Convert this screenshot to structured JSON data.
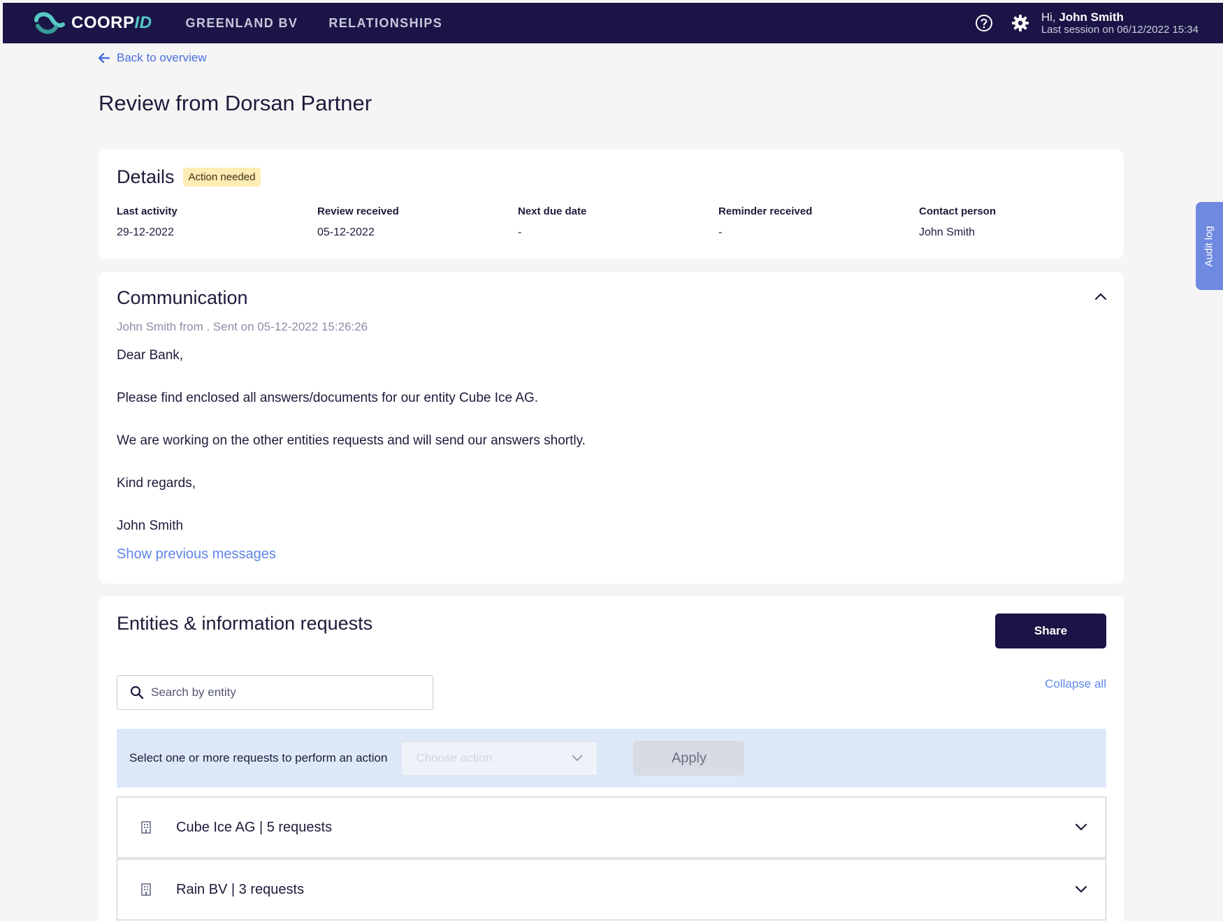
{
  "brand": {
    "name_main": "COORP",
    "name_accent": "ID"
  },
  "nav": {
    "items": [
      {
        "label": "GREENLAND BV"
      },
      {
        "label": "RELATIONSHIPS"
      }
    ]
  },
  "user": {
    "greeting": "Hi, ",
    "name": "John Smith",
    "session_label": "Last session on",
    "session_time": "06/12/2022 15:34"
  },
  "back_link": {
    "label": "Back to overview"
  },
  "page_title": "Review from Dorsan Partner",
  "details": {
    "title": "Details",
    "badge": "Action needed",
    "fields": [
      {
        "label": "Last activity",
        "value": "29-12-2022"
      },
      {
        "label": "Review received",
        "value": "05-12-2022"
      },
      {
        "label": "Next due date",
        "value": "-"
      },
      {
        "label": "Reminder received",
        "value": "-"
      },
      {
        "label": "Contact person",
        "value": "John Smith"
      }
    ]
  },
  "communication": {
    "title": "Communication",
    "sender_line": "John Smith from . Sent on 05-12-2022 15:26:26",
    "message_lines": [
      "Dear Bank,",
      "Please find enclosed all answers/documents for our entity Cube Ice AG.",
      "We are working on the other entities requests and will send our answers shortly.",
      "Kind regards,",
      "John Smith"
    ],
    "show_previous": "Show previous messages"
  },
  "entities": {
    "title": "Entities & information requests",
    "share_label": "Share",
    "search_placeholder": "Search by entity",
    "collapse_all": "Collapse all",
    "action_bar": {
      "label": "Select one or more requests to perform an action",
      "choose_action_placeholder": "Choose action",
      "apply_label": "Apply"
    },
    "rows": [
      {
        "label": "Cube Ice AG | 5 requests"
      },
      {
        "label": "Rain BV | 3 requests"
      }
    ]
  },
  "audit_tab": {
    "label": "Audit log"
  },
  "colors": {
    "nav_bg": "#1a1546",
    "accent_link": "#4a6fe0",
    "badge_bg": "#fdecb4",
    "action_bar_bg": "#dde9f9",
    "audit_tab_bg": "#6e89e0"
  }
}
